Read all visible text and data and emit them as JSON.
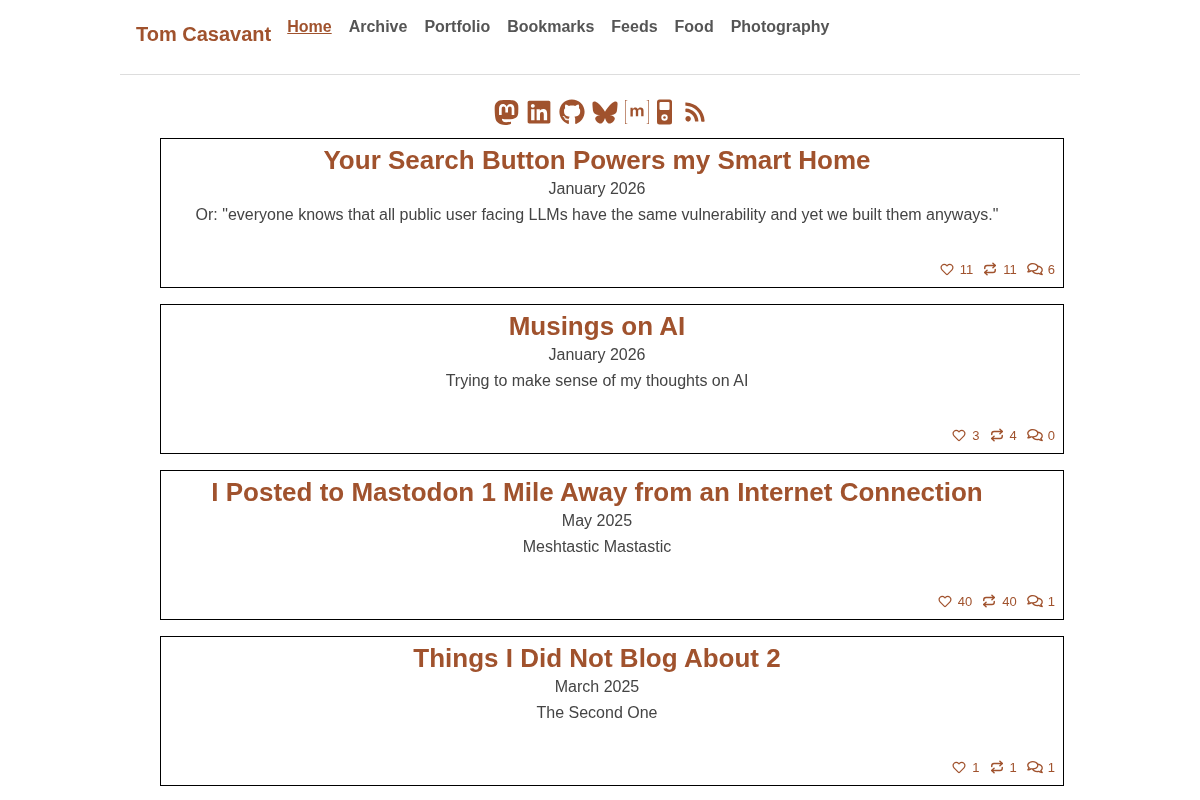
{
  "site_title": "Tom Casavant",
  "nav": [
    {
      "label": "Home",
      "selected": true
    },
    {
      "label": "Archive",
      "selected": false
    },
    {
      "label": "Portfolio",
      "selected": false
    },
    {
      "label": "Bookmarks",
      "selected": false
    },
    {
      "label": "Feeds",
      "selected": false
    },
    {
      "label": "Food",
      "selected": false
    },
    {
      "label": "Photography",
      "selected": false
    }
  ],
  "posts": [
    {
      "title": "Your Search Button Powers my Smart Home",
      "date": "January 2026",
      "summary": "Or: \"everyone knows that all public user facing LLMs have the same vulnerability and yet we built them anyways.\"",
      "likes": "11",
      "boosts": "11",
      "replies": "6"
    },
    {
      "title": "Musings on AI",
      "date": "January 2026",
      "summary": "Trying to make sense of my thoughts on AI",
      "likes": "3",
      "boosts": "4",
      "replies": "0"
    },
    {
      "title": "I Posted to Mastodon 1 Mile Away from an Internet Connection",
      "date": "May 2025",
      "summary": "Meshtastic Mastastic",
      "likes": "40",
      "boosts": "40",
      "replies": "1"
    },
    {
      "title": "Things I Did Not Blog About 2",
      "date": "March 2025",
      "summary": "The Second One",
      "likes": "1",
      "boosts": "1",
      "replies": "1"
    }
  ]
}
